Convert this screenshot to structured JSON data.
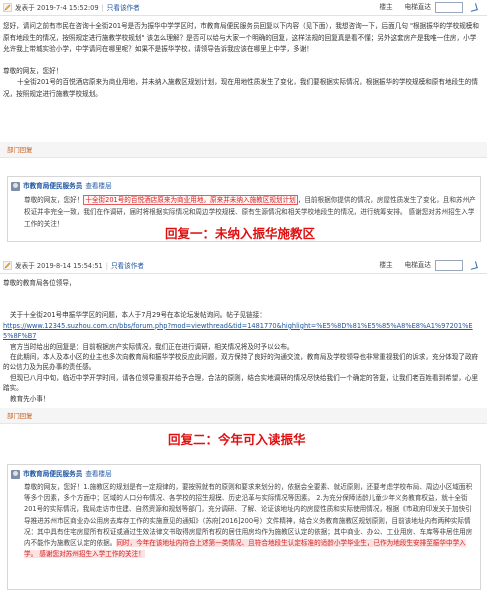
{
  "post1": {
    "date": "发表于 2019-7-4 15:52:09",
    "reading_mode": "只看该作者",
    "floor": "楼主",
    "goto": "电梯直达",
    "body": [
      "您好，请问之前有市民在咨询十全街201号是否为振华中学学区时，市教育局便民服务员回复以下内容（见下面），我想咨询一下，后面几句 \"根据振华的学校规模和原有地段生的情况，按照规定进行施教学校规划\" 该怎么理解？是否可以给与大家一个明确的回复，这样法规的回复真是看不懂；另外这套房产是我唯一住房，小学允许我上带城实验小学，中学请问在哪里呢？如果不是振华学校，请领导告诉我应该在哪里上中学，多谢！",
      "尊敬的网友，您好！",
      "十全街201号的百悦酒店原来为商业用地，并未纳入施教区规划计划，现在用地性质发生了变化，我们要根据实际情况，根据振华的学校规模和原有地段生的情况，按照规定进行施教学校规划。"
    ]
  },
  "reply1": {
    "banner": "部门回复",
    "department": "市教育局便民服务员",
    "view": "查看楼层",
    "prefix": "尊敬的网友，您好！",
    "highlight": "十全街201号的百悦酒店原来为商业用地，原来并未纳入施教区规划计划",
    "rest": "，目前根据你提供的情况，房屋性质发生了变化，且和苏州产权证并非完全一致，我们在作调研，届时将根据实际情况和周边学校规模、原有生源情况和相关学校地段生的情况，进行统筹安排。 感谢您对苏州招生入学工作的关注！"
  },
  "caption1": "回复一：未纳入振华施教区",
  "post2": {
    "date": "发表于 2019-8-14 15:54:51",
    "reading_mode": "只看该作者",
    "floor": "楼主",
    "goto": "电梯直达",
    "greeting": "尊敬的教育局各位领导，",
    "intro": "关于十全街201号申振华学区的问题，本人于7月29号在本论坛发帖询问。帖子见链接：",
    "link": "https://www.12345.suzhou.com.cn/bbs/forum.php?mod=viewthread&tid=1481770&highlight=%E5%8D%81%E5%85%A8%E8%A1%97201%E5%8F%B7",
    "body": [
      "官方当时给出的回复是：目前根据房产实际情况，我们正在进行调研，相关情况将及时予以公布。",
      "在此期间，本人及本小区的业主也多次向教育局和振华学校反应此问题，双方保持了良好的沟通交流，教育局及学校领导也非常重视我们的诉求，充分体现了政府的公信力及为民办事的责任感。",
      "但现已八月中旬，临近中学开学时间，请各位领导重视并给予合理，合法的原则，结合实地调研的情况尽快给我们一个确定的答复，让我们老百姓看到希望，心里踏实。",
      "教育先小事！"
    ]
  },
  "reply2": {
    "banner": "部门回复",
    "department": "市教育局便民服务员",
    "view": "查看楼层",
    "text": "尊敬的网友，您好！1.施教区的规划是有一定规律的，要按照就有的原则和要求来划分的，依据会全要素、就近原则，还要考虑学校布局、周边小区域面积等多个因素，多个方面中；区域的人口分布情况、各学校的招生规模、历史沿革与实际情况等因素。 2.为充分保障适龄儿童少年义务教育权益，就十全街201号的实际情况，我局走访市住建、自然资源和规划等部门，充分调研、了解、论证该地址内的房屋性质和实际使用情况，根据《市政府印发关于加快引导推进苏州市区商业办公用房去库存工作的实施意见的通知》（苏府[2016]200号）文件精神，结合义务教育施教区规划原则，目前该地址内有两种实际情况：其中具有住宅房屋所有权证或通过生效法律文书取得房屋所有权的居住用房均作为施教区认定的依据；其中商业、办公、工业用房、车库等非居住用房内不能作为施教区认定的依据。",
    "highlight": "同时，今年在该地址内符合上述第一类情况、且符合地段生认定标准的适龄小学毕业生，已作为地段生安排至振华中学入学。 感谢您对苏州招生入学工作的关注！"
  },
  "caption2": "回复二：今年可入读振华"
}
